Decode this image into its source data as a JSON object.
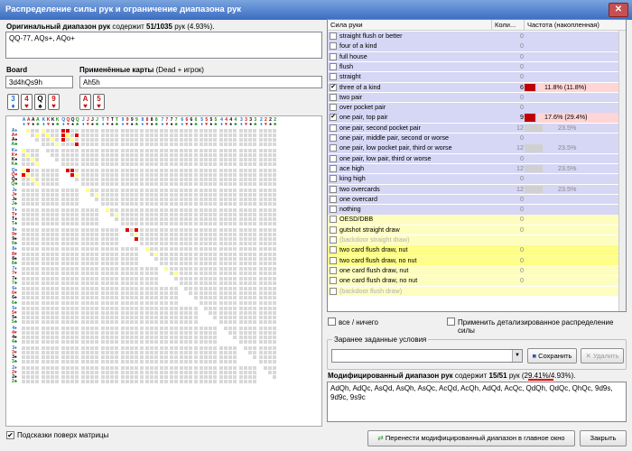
{
  "window": {
    "title": "Распределение силы рук и ограничение диапазона рук"
  },
  "orig": {
    "label": "Оригинальный диапазон рук",
    "contains_word": "содержит",
    "count": "51/1035",
    "suffix": "рук (4.93%).",
    "value": "QQ-77, AQs+, AQo+"
  },
  "board": {
    "label": "Board",
    "value": "3d4hQs9h",
    "cards": [
      {
        "r": "3",
        "s": "♦",
        "c": "#1e6fc9"
      },
      {
        "r": "4",
        "s": "♥",
        "c": "#d01010"
      },
      {
        "r": "Q",
        "s": "♠",
        "c": "#000"
      },
      {
        "r": "9",
        "s": "♥",
        "c": "#d01010"
      }
    ]
  },
  "dead": {
    "label": "Применённые карты",
    "label_hint": "(Dead + игрок)",
    "value": "Ah5h",
    "cards": [
      {
        "r": "A",
        "s": "♥",
        "c": "#d01010"
      },
      {
        "r": "5",
        "s": "♥",
        "c": "#d01010"
      }
    ]
  },
  "table": {
    "headers": [
      "Сила руки",
      "Коли...",
      "Частота (накопленная)"
    ],
    "rows": [
      {
        "name": "straight flush or better",
        "count": "0",
        "pct": "",
        "bg": "#d6d6f5",
        "checked": false,
        "bar": 0
      },
      {
        "name": "four of a kind",
        "count": "0",
        "pct": "",
        "bg": "#d6d6f5",
        "checked": false,
        "bar": 0
      },
      {
        "name": "full house",
        "count": "0",
        "pct": "",
        "bg": "#d6d6f5",
        "checked": false,
        "bar": 0
      },
      {
        "name": "flush",
        "count": "0",
        "pct": "",
        "bg": "#d6d6f5",
        "checked": false,
        "bar": 0
      },
      {
        "name": "straight",
        "count": "0",
        "pct": "",
        "bg": "#d6d6f5",
        "checked": false,
        "bar": 0
      },
      {
        "name": "three of a kind",
        "count": "6",
        "pct": "11.8% (11.8%)",
        "bg": "#d6d6f5",
        "checked": true,
        "bar": 1,
        "hl": true
      },
      {
        "name": "two pair",
        "count": "0",
        "pct": "",
        "bg": "#d6d6f5",
        "checked": false,
        "bar": 0
      },
      {
        "name": "over pocket pair",
        "count": "0",
        "pct": "",
        "bg": "#d6d6f5",
        "checked": false,
        "bar": 0
      },
      {
        "name": "one pair, top pair",
        "count": "9",
        "pct": "17.6% (29.4%)",
        "bg": "#d6d6f5",
        "checked": true,
        "bar": 1,
        "hl": true
      },
      {
        "name": "one pair, second pocket pair",
        "count": "12",
        "pct": "23.5%",
        "bg": "#d6d6f5",
        "checked": false,
        "bar": 2
      },
      {
        "name": "one pair, middle pair, second or worse",
        "count": "0",
        "pct": "",
        "bg": "#d6d6f5",
        "checked": false,
        "bar": 0
      },
      {
        "name": "one pair, low pocket pair, third or worse",
        "count": "12",
        "pct": "23.5%",
        "bg": "#d6d6f5",
        "checked": false,
        "bar": 2
      },
      {
        "name": "one pair, low pair, third or worse",
        "count": "0",
        "pct": "",
        "bg": "#d6d6f5",
        "checked": false,
        "bar": 0
      },
      {
        "name": "ace high",
        "count": "12",
        "pct": "23.5%",
        "bg": "#d6d6f5",
        "checked": false,
        "bar": 2
      },
      {
        "name": "king high",
        "count": "0",
        "pct": "",
        "bg": "#d6d6f5",
        "checked": false,
        "bar": 0
      },
      {
        "name": "two overcards",
        "count": "12",
        "pct": "23.5%",
        "bg": "#d6d6f5",
        "checked": false,
        "bar": 2
      },
      {
        "name": "one overcard",
        "count": "0",
        "pct": "",
        "bg": "#d6d6f5",
        "checked": false,
        "bar": 0
      },
      {
        "name": "nothing",
        "count": "0",
        "pct": "",
        "bg": "#d6d6f5",
        "checked": false,
        "bar": 0
      },
      {
        "name": "OESD/DBB",
        "count": "0",
        "pct": "",
        "bg": "#fdfdc0",
        "checked": false,
        "bar": 0
      },
      {
        "name": "gutshot straight draw",
        "count": "0",
        "pct": "",
        "bg": "#fdfdc0",
        "checked": false,
        "bar": 0
      },
      {
        "name": "(backdoor straight draw)",
        "count": "",
        "pct": "",
        "bg": "#fdfdc0",
        "checked": false,
        "bar": 0,
        "gray": true
      },
      {
        "name": "two card flush draw, nut",
        "count": "0",
        "pct": "",
        "bg": "#fdfd88",
        "checked": false,
        "bar": 0
      },
      {
        "name": "two card flush draw, no nut",
        "count": "0",
        "pct": "",
        "bg": "#fdfd88",
        "checked": false,
        "bar": 0
      },
      {
        "name": "one card flush draw, nut",
        "count": "0",
        "pct": "",
        "bg": "#fdfdc0",
        "checked": false,
        "bar": 0
      },
      {
        "name": "one card flush draw, no nut",
        "count": "0",
        "pct": "",
        "bg": "#fdfdc0",
        "checked": false,
        "bar": 0
      },
      {
        "name": "(backdoor flush draw)",
        "count": "",
        "pct": "",
        "bg": "#fdfdc0",
        "checked": false,
        "bar": 0,
        "gray": true
      }
    ]
  },
  "opts": {
    "all_none": "все / ничего",
    "detailed": "Применить детализированное распределение силы"
  },
  "preset": {
    "legend": "Заранее заданные условия",
    "save": "Сохранить",
    "delete": "Удалить"
  },
  "mod": {
    "label": "Модифицированный диапазон рук",
    "contains_word": "содержит",
    "count": "15/51",
    "suffix": "рук (29.41%/4.93%).",
    "value": "AdQh, AdQc, AsQd, AsQh, AsQc, AcQd, AcQh, AdQd, AcQc, QdQh, QdQc, QhQc, 9d9s, 9d9c, 9s9c"
  },
  "footer": {
    "hints": "Подсказки поверх матрицы",
    "transfer": "Перенести модифицированный диапазон в главное окно",
    "close": "Закрыть"
  },
  "matrix": {
    "ranks": [
      "A",
      "K",
      "Q",
      "J",
      "T",
      "9",
      "8",
      "7",
      "6",
      "5",
      "4",
      "3",
      "2"
    ],
    "suits": [
      {
        "s": "♦",
        "c": "#1e6fc9"
      },
      {
        "s": "♥",
        "c": "#d01010"
      },
      {
        "s": "♠",
        "c": "#000"
      },
      {
        "s": "♣",
        "c": "#1a8a1a"
      }
    ],
    "colors": {
      "empty": "#d8d8d8",
      "range": "#ffff80",
      "selected": "#e00000"
    }
  }
}
